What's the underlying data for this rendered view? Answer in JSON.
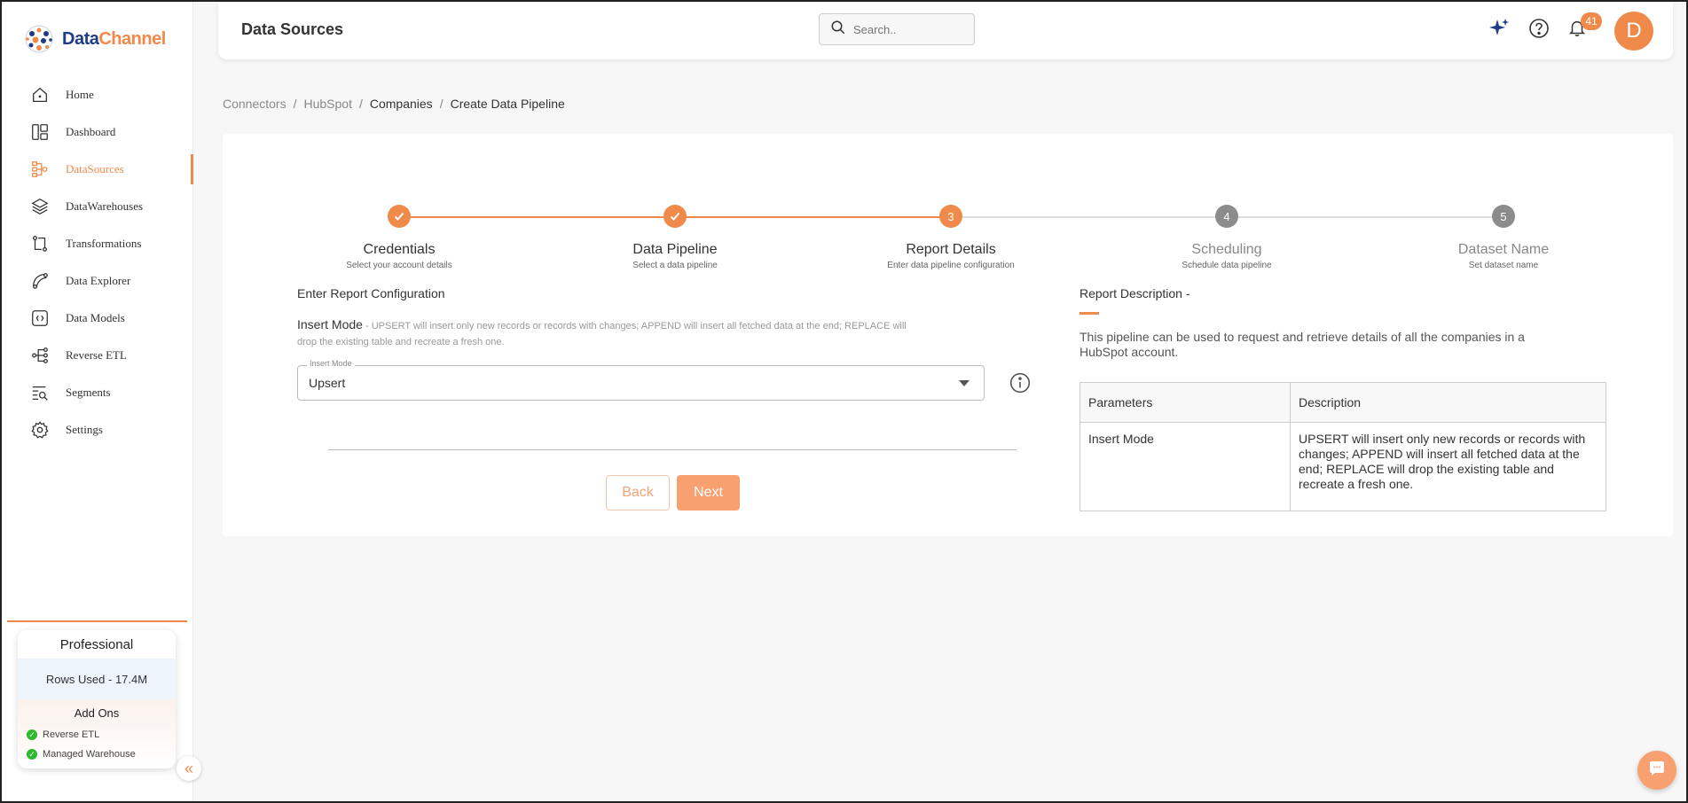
{
  "brand": {
    "name_part1": "Data",
    "name_part2": "Channel"
  },
  "colors": {
    "accent": "#f08a4b",
    "brand_blue": "#1f3c88",
    "success": "#2eb82e",
    "muted_step": "#8c8c8c"
  },
  "sidebar": {
    "items": [
      {
        "label": "Home",
        "icon": "home-icon"
      },
      {
        "label": "Dashboard",
        "icon": "dashboard-icon"
      },
      {
        "label": "DataSources",
        "icon": "datasources-icon",
        "active": true
      },
      {
        "label": "DataWarehouses",
        "icon": "layers-icon"
      },
      {
        "label": "Transformations",
        "icon": "transform-icon"
      },
      {
        "label": "Data Explorer",
        "icon": "explorer-icon"
      },
      {
        "label": "Data Models",
        "icon": "data-models-icon"
      },
      {
        "label": "Reverse ETL",
        "icon": "reverse-etl-icon"
      },
      {
        "label": "Segments",
        "icon": "segments-icon"
      },
      {
        "label": "Settings",
        "icon": "gear-icon"
      }
    ],
    "plan": {
      "name": "Professional",
      "rows_used": "Rows Used - 17.4M",
      "addons_title": "Add Ons",
      "addons": [
        "Reverse ETL",
        "Managed Warehouse"
      ]
    }
  },
  "header": {
    "title": "Data Sources",
    "search_placeholder": "Search..",
    "notifications_count": "41",
    "avatar_initial": "D"
  },
  "breadcrumb": [
    "Connectors",
    "HubSpot",
    "Companies",
    "Create Data Pipeline"
  ],
  "stepper": {
    "steps": [
      {
        "title": "Credentials",
        "subtitle": "Select your account details",
        "status": "done",
        "number": "1"
      },
      {
        "title": "Data Pipeline",
        "subtitle": "Select a data pipeline",
        "status": "done",
        "number": "2"
      },
      {
        "title": "Report Details",
        "subtitle": "Enter data pipeline configuration",
        "status": "active",
        "number": "3"
      },
      {
        "title": "Scheduling",
        "subtitle": "Schedule data pipeline",
        "status": "todo",
        "number": "4"
      },
      {
        "title": "Dataset Name",
        "subtitle": "Set dataset name",
        "status": "todo",
        "number": "5"
      }
    ]
  },
  "form": {
    "title": "Enter Report Configuration",
    "insert_mode_heading": "Insert Mode",
    "insert_mode_help": " - UPSERT will insert only new records or records with changes; APPEND will insert all fetched data at the end; REPLACE will drop the existing table and recreate a fresh one.",
    "select_label": "Insert Mode",
    "select_value": "Upsert",
    "back_label": "Back",
    "next_label": "Next"
  },
  "description": {
    "title": "Report Description -",
    "text": "This pipeline can be used to request and retrieve details of all the companies in a HubSpot account.",
    "table": {
      "headers": [
        "Parameters",
        "Description"
      ],
      "rows": [
        [
          "Insert Mode",
          "UPSERT will insert only new records or records with changes; APPEND will insert all fetched data at the end; REPLACE will drop the existing table and recreate a fresh one."
        ]
      ]
    }
  }
}
